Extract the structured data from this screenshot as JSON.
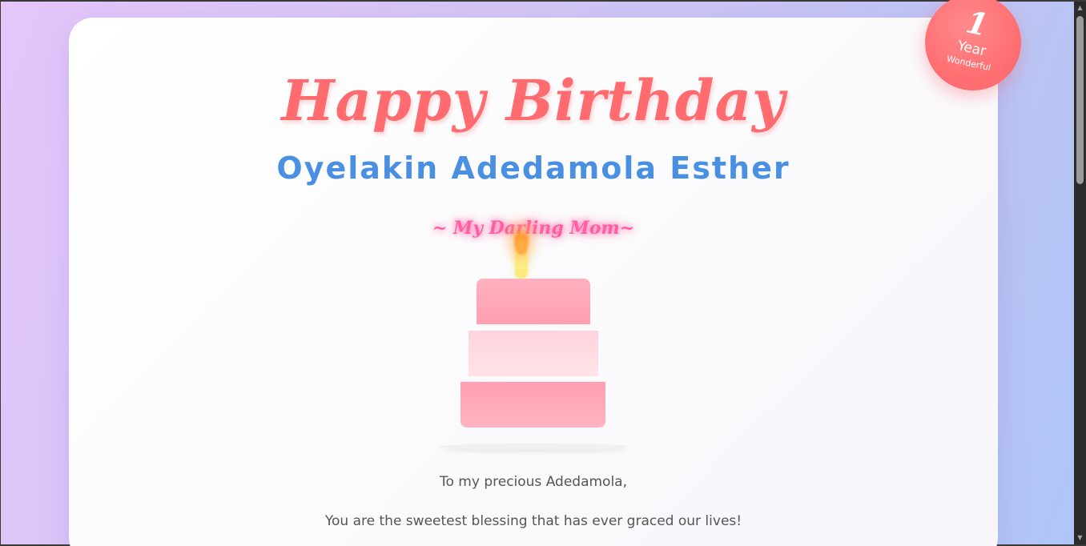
{
  "card": {
    "title": "Happy Birthday",
    "name": "Oyelakin Adedamola Esther",
    "subtitle": "~ My Darling Mom~",
    "message_lines": [
      "To my precious Adedamola,",
      "You are the sweetest blessing that has ever graced our lives!"
    ]
  },
  "badge": {
    "number": "1",
    "year": "Year",
    "word": "Wonderful"
  },
  "scrollbar": {
    "up_icon": "▲",
    "down_icon": "▼"
  },
  "colors": {
    "title": "#ff6b6e",
    "name": "#4a90e2",
    "subtitle": "#ff5fa2",
    "badge": "#ff6f72"
  }
}
